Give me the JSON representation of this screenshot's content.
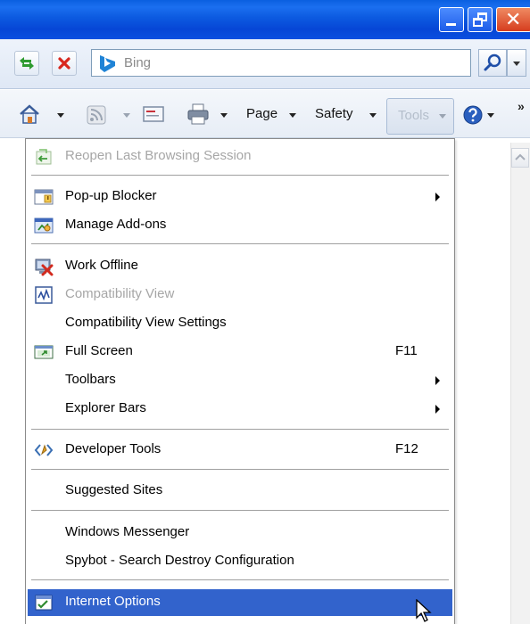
{
  "window": {
    "accent": "#0a4fe0",
    "controls": [
      "minimize-icon",
      "restore-icon",
      "close-icon"
    ]
  },
  "address_bar": {
    "search_placeholder": "Bing",
    "buttons": [
      "refresh-icon",
      "stop-icon",
      "search-icon",
      "dropdown-icon"
    ]
  },
  "command_bar": {
    "page_label": "Page",
    "safety_label": "Safety",
    "tools_label": "Tools",
    "overflow_label": "»"
  },
  "tools_menu": {
    "highlight_color": "#3263cc",
    "items": [
      {
        "label": "Reopen Last Browsing Session",
        "icon": "reopen-session-icon",
        "disabled": true
      },
      {
        "label": "Pop-up Blocker",
        "icon": "popup-blocker-icon",
        "submenu": true
      },
      {
        "label": "Manage Add-ons",
        "icon": "addons-icon"
      },
      {
        "label": "Work Offline",
        "icon": "work-offline-icon"
      },
      {
        "label": "Compatibility View",
        "icon": "compatibility-view-icon",
        "disabled": true
      },
      {
        "label": "Compatibility View Settings",
        "icon": ""
      },
      {
        "label": "Full Screen",
        "icon": "full-screen-icon",
        "shortcut": "F11"
      },
      {
        "label": "Toolbars",
        "icon": "",
        "submenu": true
      },
      {
        "label": "Explorer Bars",
        "icon": "",
        "submenu": true
      },
      {
        "label": "Developer Tools",
        "icon": "developer-tools-icon",
        "shortcut": "F12"
      },
      {
        "label": "Suggested Sites",
        "icon": ""
      },
      {
        "label": "Windows Messenger",
        "icon": ""
      },
      {
        "label": "Spybot - Search  Destroy Configuration",
        "icon": ""
      },
      {
        "label": "Internet Options",
        "icon": "internet-options-icon",
        "highlighted": true
      }
    ]
  }
}
